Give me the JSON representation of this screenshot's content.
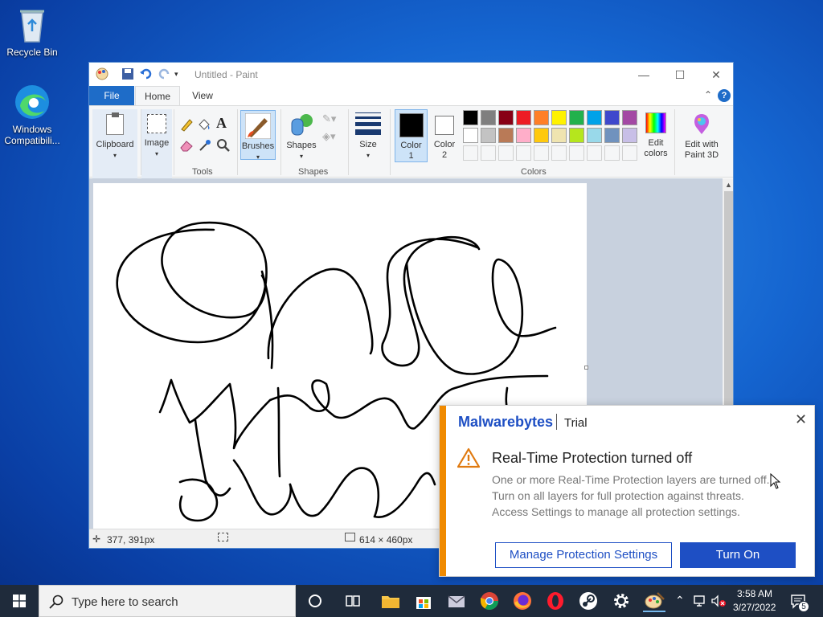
{
  "desktop": {
    "recycle_bin": "Recycle Bin",
    "compat_line1": "Windows",
    "compat_line2": "Compatibili..."
  },
  "paint": {
    "title": "Untitled - Paint",
    "tabs": {
      "file": "File",
      "home": "Home",
      "view": "View"
    },
    "groups": {
      "tools": "Tools",
      "shapes": "Shapes",
      "colors": "Colors"
    },
    "buttons": {
      "clipboard": "Clipboard",
      "image": "Image",
      "brushes": "Brushes",
      "shapes": "Shapes",
      "size": "Size",
      "color1_a": "Color",
      "color1_b": "1",
      "color2_a": "Color",
      "color2_b": "2",
      "edit_colors_a": "Edit",
      "edit_colors_b": "colors",
      "paint3d_a": "Edit with",
      "paint3d_b": "Paint 3D"
    },
    "palette_row1": [
      "#000000",
      "#7f7f7f",
      "#880015",
      "#ed1c24",
      "#ff7f27",
      "#fff200",
      "#22b14c",
      "#00a2e8",
      "#3f48cc",
      "#a349a4"
    ],
    "palette_row2": [
      "#ffffff",
      "#c3c3c3",
      "#b97a57",
      "#ffaec9",
      "#ffc90e",
      "#efe4b0",
      "#b5e61d",
      "#99d9ea",
      "#7092be",
      "#c8bfe7"
    ],
    "status": {
      "cursor_pos": "377, 391px",
      "canvas_size": "614 × 460px"
    }
  },
  "malwarebytes": {
    "brand": "Malwarebytes",
    "edition": "Trial",
    "heading": "Real-Time Protection turned off",
    "line1": "One or more Real-Time Protection layers are turned off.",
    "line2": "Turn on all layers for full protection against threats.",
    "line3": "Access Settings to manage all protection settings.",
    "manage_button": "Manage Protection Settings",
    "turn_on_button": "Turn On",
    "accent_color": "#f08a00",
    "primary_color": "#1e4fc4"
  },
  "taskbar": {
    "search_placeholder": "Type here to search",
    "time": "3:58 AM",
    "date": "3/27/2022",
    "notification_count": "5"
  }
}
